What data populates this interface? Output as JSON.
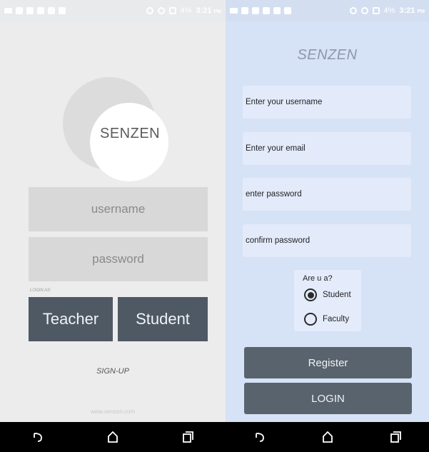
{
  "status": {
    "time": "3:21",
    "ampm": "PM",
    "battery": "4%"
  },
  "login_screen": {
    "logo_text": "SENZEN",
    "username_placeholder": "username",
    "password_placeholder": "password",
    "login_as_label": "LOGIN AS:",
    "teacher_label": "Teacher",
    "student_label": "Student",
    "signup_label": "SIGN-UP",
    "footer": "www.senzen.com"
  },
  "register_screen": {
    "title": "SENZEN",
    "username_placeholder": "Enter your username",
    "email_placeholder": "Enter your email",
    "password_placeholder": "enter password",
    "confirm_placeholder": "confirm password",
    "question": "Are u a?",
    "options": [
      {
        "label": "Student",
        "selected": true
      },
      {
        "label": "Faculty",
        "selected": false
      }
    ],
    "register_label": "Register",
    "login_label": "LOGIN"
  },
  "nav_icons": [
    "back-icon",
    "home-icon",
    "recents-icon"
  ],
  "colors": {
    "dark_button": "#4e5964",
    "right_bg": "#d6e2f6",
    "left_bg": "#ececec"
  }
}
